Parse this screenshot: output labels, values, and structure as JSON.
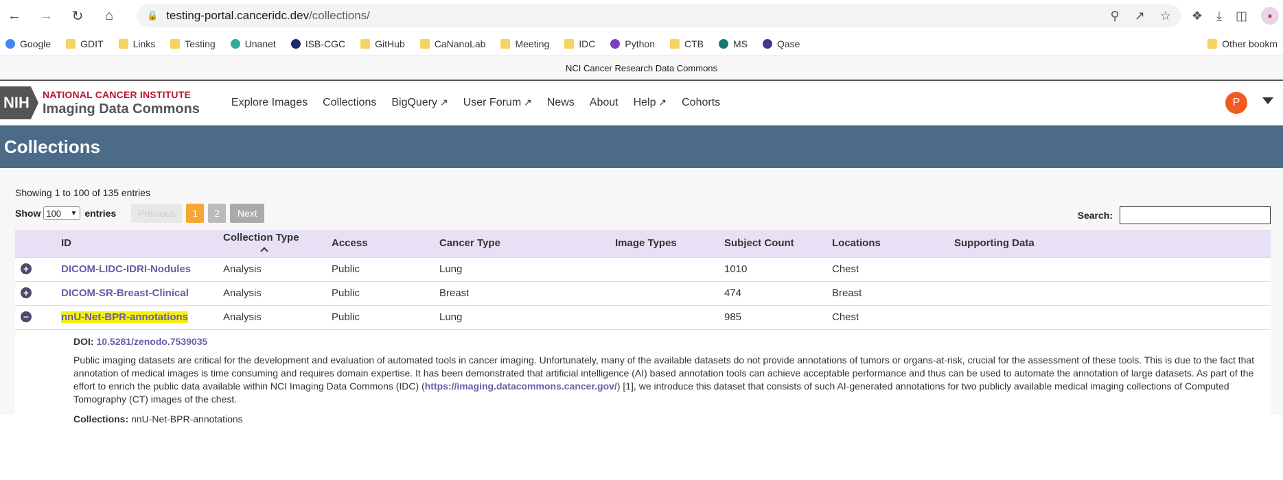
{
  "browser": {
    "url_host": "testing-portal.canceridc.dev",
    "url_path": "/collections/"
  },
  "bookmarks": [
    {
      "label": "Google",
      "icon": "google-icon"
    },
    {
      "label": "GDIT",
      "icon": "folder-icon"
    },
    {
      "label": "Links",
      "icon": "folder-icon"
    },
    {
      "label": "Testing",
      "icon": "folder-icon"
    },
    {
      "label": "Unanet",
      "icon": "unanet-icon"
    },
    {
      "label": "ISB-CGC",
      "icon": "isb-icon"
    },
    {
      "label": "GitHub",
      "icon": "folder-icon"
    },
    {
      "label": "CaNanoLab",
      "icon": "folder-icon"
    },
    {
      "label": "Meeting",
      "icon": "folder-icon"
    },
    {
      "label": "IDC",
      "icon": "folder-icon"
    },
    {
      "label": "Python",
      "icon": "python-icon"
    },
    {
      "label": "CTB",
      "icon": "folder-icon"
    },
    {
      "label": "MS",
      "icon": "sharepoint-icon"
    },
    {
      "label": "Qase",
      "icon": "qase-icon"
    }
  ],
  "bookmarks_other": "Other bookm",
  "banner": "NCI Cancer Research Data Commons",
  "logo": {
    "nih": "NIH",
    "line1": "NATIONAL CANCER INSTITUTE",
    "line2": "Imaging Data Commons"
  },
  "nav": [
    {
      "label": "Explore Images"
    },
    {
      "label": "Collections"
    },
    {
      "label": "BigQuery",
      "external": true
    },
    {
      "label": "User Forum",
      "external": true
    },
    {
      "label": "News"
    },
    {
      "label": "About"
    },
    {
      "label": "Help",
      "external": true
    },
    {
      "label": "Cohorts"
    }
  ],
  "user": {
    "initial": "P"
  },
  "page_title": "Collections",
  "table_info": "Showing 1 to 100 of 135 entries",
  "length": {
    "show": "Show",
    "value": "100",
    "entries": "entries"
  },
  "pager": {
    "previous": "Previous",
    "pages": [
      "1",
      "2"
    ],
    "next": "Next"
  },
  "search": {
    "label": "Search:",
    "value": ""
  },
  "columns": [
    "ID",
    "Collection Type",
    "Access",
    "Cancer Type",
    "Image Types",
    "Subject Count",
    "Locations",
    "Supporting Data"
  ],
  "rows": [
    {
      "id": "DICOM-LIDC-IDRI-Nodules",
      "type": "Analysis",
      "access": "Public",
      "cancer": "Lung",
      "image_types": "",
      "count": "1010",
      "location": "Chest",
      "supporting": "",
      "expanded": false
    },
    {
      "id": "DICOM-SR-Breast-Clinical",
      "type": "Analysis",
      "access": "Public",
      "cancer": "Breast",
      "image_types": "",
      "count": "474",
      "location": "Breast",
      "supporting": "",
      "expanded": false
    },
    {
      "id": "nnU-Net-BPR-annotations",
      "type": "Analysis",
      "access": "Public",
      "cancer": "Lung",
      "image_types": "",
      "count": "985",
      "location": "Chest",
      "supporting": "",
      "expanded": true
    }
  ],
  "detail": {
    "doi_label": "DOI:",
    "doi": "10.5281/zenodo.7539035",
    "para_before": "Public imaging datasets are critical for the development and evaluation of automated tools in cancer imaging. Unfortunately, many of the available datasets do not provide annotations of tumors or  organs-at-risk, crucial for the assessment of these tools. This is due to the fact that annotation of medical images is time consuming and requires domain expertise. It has been demonstrated that artificial intelligence (AI) based annotation tools can achieve acceptable performance and thus can be used to automate the annotation of large datasets. As part of the effort to enrich the public data available within NCI Imaging Data Commons (IDC) (",
    "link": "https://imaging.datacommons.cancer.gov/",
    "para_after": ") [1], we introduce this dataset that consists of such AI-generated annotations for two publicly available medical imaging collections of Computed Tomography (CT) images of the chest.",
    "collections_label": "Collections:",
    "collections_value": "nnU-Net-BPR-annotations"
  },
  "colors": {
    "title_bar": "#4c6b89",
    "header_row": "#e8e0f5",
    "link": "#6b5ca5",
    "highlight": "#f5f014",
    "current_page": "#f7a731"
  }
}
